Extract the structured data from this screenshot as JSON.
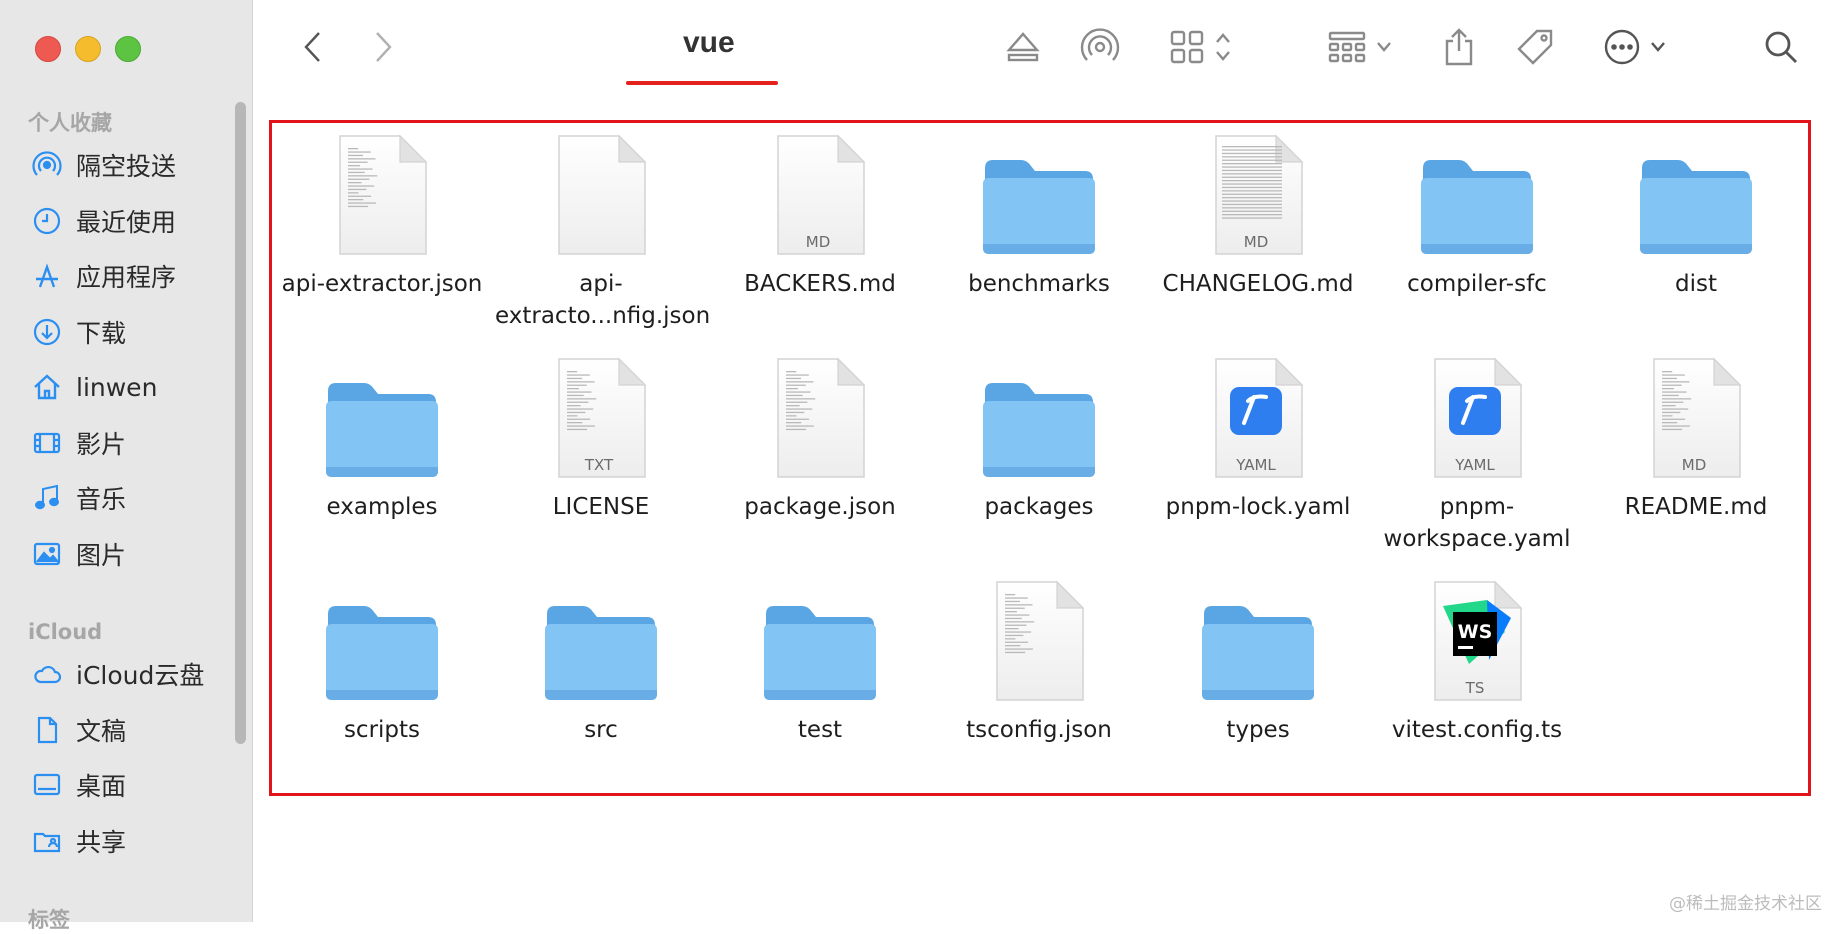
{
  "sidebar": {
    "favorites_title": "个人收藏",
    "favorites": [
      {
        "label": "隔空投送",
        "icon": "airdrop-icon"
      },
      {
        "label": "最近使用",
        "icon": "clock-icon"
      },
      {
        "label": "应用程序",
        "icon": "applications-icon"
      },
      {
        "label": "下载",
        "icon": "download-icon"
      },
      {
        "label": "linwen",
        "icon": "home-icon"
      },
      {
        "label": "影片",
        "icon": "film-icon"
      },
      {
        "label": "音乐",
        "icon": "music-icon"
      },
      {
        "label": "图片",
        "icon": "photo-icon"
      }
    ],
    "icloud_title": "iCloud",
    "icloud": [
      {
        "label": "iCloud云盘",
        "icon": "cloud-icon"
      },
      {
        "label": "文稿",
        "icon": "document-icon"
      },
      {
        "label": "桌面",
        "icon": "desktop-icon"
      },
      {
        "label": "共享",
        "icon": "shared-folder-icon"
      }
    ],
    "tags_title": "标签"
  },
  "toolbar": {
    "title": "vue",
    "buttons": [
      "back-icon",
      "forward-icon",
      "eject-icon",
      "airdrop-icon",
      "grid-view-icon",
      "group-icon",
      "share-icon",
      "tag-icon",
      "more-icon",
      "search-icon"
    ]
  },
  "files": [
    {
      "name": "api-extractor.json",
      "kind": "doc",
      "badge": ""
    },
    {
      "name": "api-extracto...nfig.json",
      "kind": "blank",
      "badge": ""
    },
    {
      "name": "BACKERS.md",
      "kind": "doc-empty",
      "badge": "MD"
    },
    {
      "name": "benchmarks",
      "kind": "folder",
      "badge": ""
    },
    {
      "name": "CHANGELOG.md",
      "kind": "doc-dense",
      "badge": "MD"
    },
    {
      "name": "compiler-sfc",
      "kind": "folder",
      "badge": ""
    },
    {
      "name": "dist",
      "kind": "folder",
      "badge": ""
    },
    {
      "name": "examples",
      "kind": "folder",
      "badge": ""
    },
    {
      "name": "LICENSE",
      "kind": "doc",
      "badge": "TXT"
    },
    {
      "name": "package.json",
      "kind": "doc",
      "badge": ""
    },
    {
      "name": "packages",
      "kind": "folder",
      "badge": ""
    },
    {
      "name": "pnpm-lock.yaml",
      "kind": "yaml",
      "badge": "YAML"
    },
    {
      "name": "pnpm-workspace.yaml",
      "kind": "yaml",
      "badge": "YAML"
    },
    {
      "name": "README.md",
      "kind": "doc",
      "badge": "MD"
    },
    {
      "name": "scripts",
      "kind": "folder",
      "badge": ""
    },
    {
      "name": "src",
      "kind": "folder",
      "badge": ""
    },
    {
      "name": "test",
      "kind": "folder",
      "badge": ""
    },
    {
      "name": "tsconfig.json",
      "kind": "doc",
      "badge": ""
    },
    {
      "name": "types",
      "kind": "folder",
      "badge": ""
    },
    {
      "name": "vitest.config.ts",
      "kind": "ws",
      "badge": "TS"
    }
  ],
  "watermark": "@稀土掘金技术社区",
  "colors": {
    "accent_red": "#e0141a",
    "folder": "#7fc0f0",
    "yaml_blue": "#2f7ef0"
  }
}
